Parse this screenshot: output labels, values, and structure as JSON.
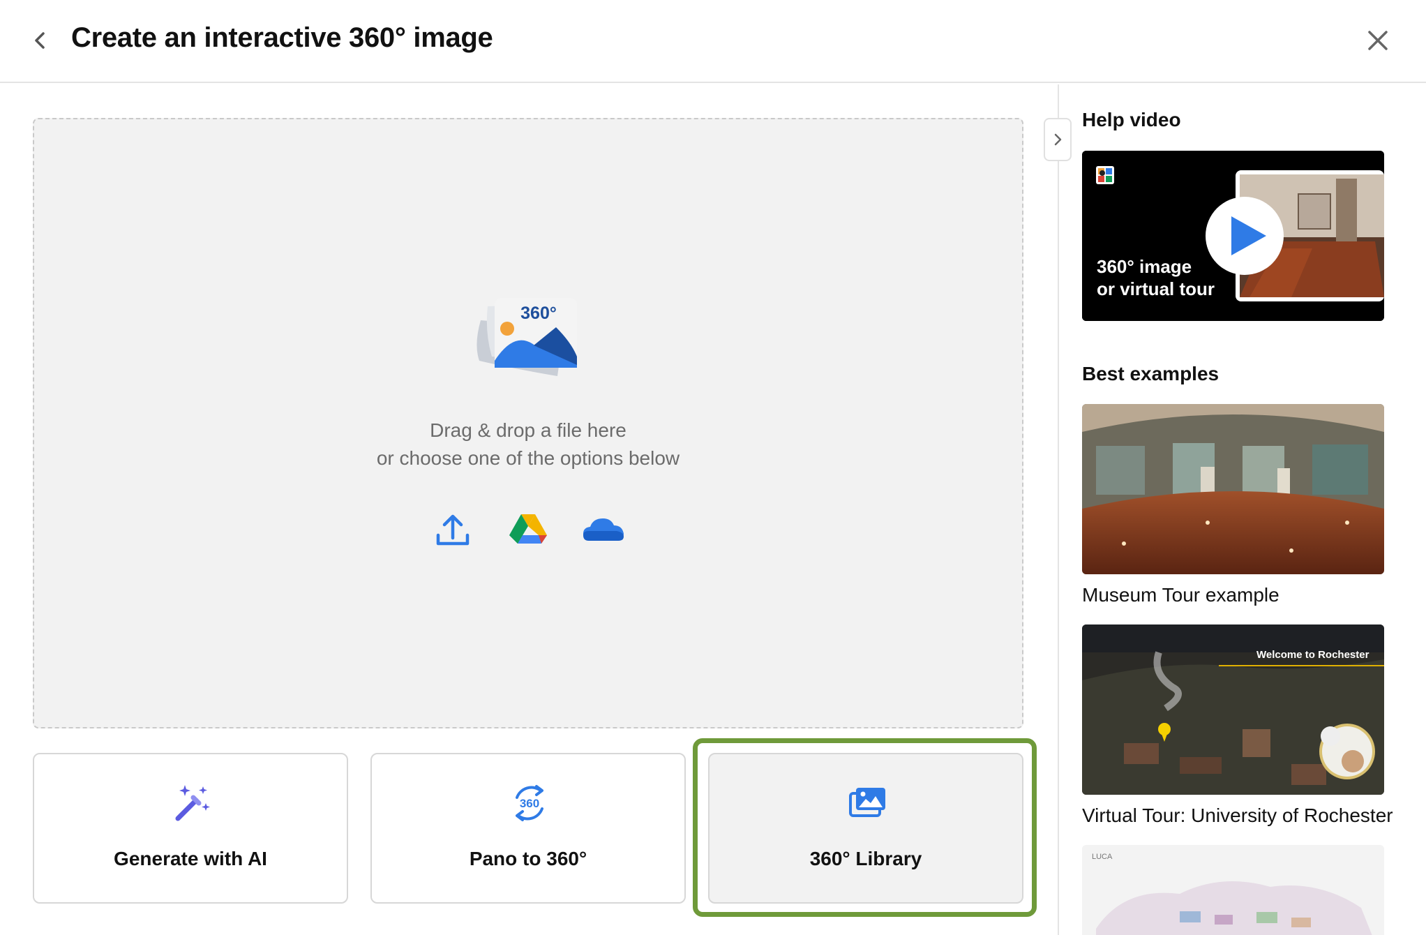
{
  "header": {
    "title": "Create an interactive 360° image",
    "back_icon": "chevron-left-icon",
    "close_icon": "close-icon"
  },
  "dropzone": {
    "illustration_badge": "360°",
    "line1": "Drag & drop a file here",
    "line2": "or choose one of the options below",
    "sources": [
      "upload-icon",
      "google-drive-icon",
      "onedrive-icon"
    ]
  },
  "options": {
    "generate_ai": "Generate with AI",
    "pano_to_360": "Pano to 360°",
    "pano_badge": "360",
    "library": "360° Library"
  },
  "sidebar": {
    "help_heading": "Help video",
    "video_caption_line1": "360° image",
    "video_caption_line2": "or virtual tour",
    "examples_heading": "Best examples",
    "examples": [
      {
        "label": "Museum Tour example"
      },
      {
        "label": "Virtual Tour: University of Rochester",
        "overlay_title": "Welcome to Rochester"
      },
      {
        "overlay_title": "LUCA"
      }
    ]
  },
  "colors": {
    "accent_blue": "#2f7be6",
    "highlight_green": "#6f9a3a",
    "ai_purple": "#5b5be0"
  }
}
